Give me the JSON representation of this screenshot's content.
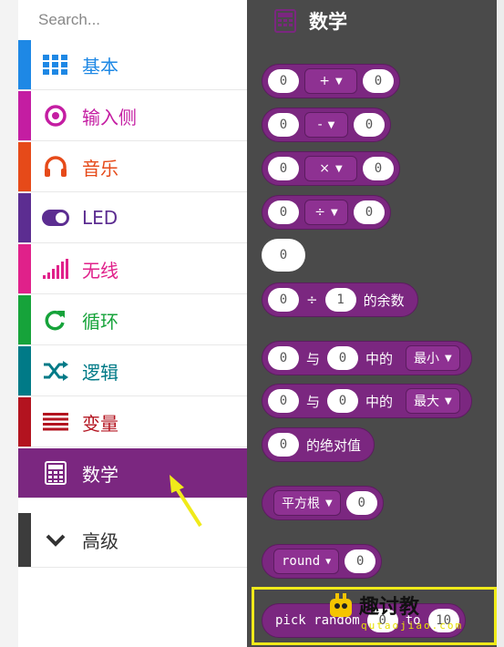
{
  "search": {
    "placeholder": "Search..."
  },
  "categories": [
    {
      "label": "基本",
      "color": "#1e88e5",
      "icon": "grid-icon"
    },
    {
      "label": "输入侧",
      "color": "#c41da2",
      "icon": "target-icon"
    },
    {
      "label": "音乐",
      "color": "#e64a19",
      "icon": "headphones-icon"
    },
    {
      "label": "LED",
      "color": "#5c2d91",
      "icon": "toggle-icon"
    },
    {
      "label": "无线",
      "color": "#e0218a",
      "icon": "signal-bars-icon"
    },
    {
      "label": "循环",
      "color": "#16a33a",
      "icon": "refresh-icon"
    },
    {
      "label": "逻辑",
      "color": "#007a87",
      "icon": "shuffle-icon"
    },
    {
      "label": "变量",
      "color": "#b3131f",
      "icon": "lines-icon"
    },
    {
      "label": "数学",
      "color": "#7b2780",
      "icon": "calculator-icon"
    },
    {
      "label": "高级",
      "color": "#3c3c3c",
      "icon": "chevron-down-icon"
    }
  ],
  "workspace": {
    "title": "数学",
    "blocks": {
      "add": {
        "a": "0",
        "op": "+",
        "b": "0"
      },
      "sub": {
        "a": "0",
        "op": "-",
        "b": "0"
      },
      "mul": {
        "a": "0",
        "op": "×",
        "b": "0"
      },
      "div": {
        "a": "0",
        "op": "÷",
        "b": "0"
      },
      "number": {
        "value": "0"
      },
      "mod": {
        "a": "0",
        "op": "÷",
        "b": "1",
        "suffix": "的余数"
      },
      "min": {
        "a": "0",
        "and": "与",
        "b": "0",
        "mid": "中的",
        "fn": "最小"
      },
      "max": {
        "a": "0",
        "and": "与",
        "b": "0",
        "mid": "中的",
        "fn": "最大"
      },
      "abs": {
        "a": "0",
        "label": "的绝对值"
      },
      "sqrt": {
        "fn": "平方根",
        "a": "0"
      },
      "round": {
        "fn": "round",
        "a": "0"
      },
      "random": {
        "label": "pick random",
        "a": "0",
        "to": "to",
        "b": "10"
      }
    }
  },
  "watermark": {
    "text": "趣讨教",
    "url": "qutaojiao.com"
  }
}
